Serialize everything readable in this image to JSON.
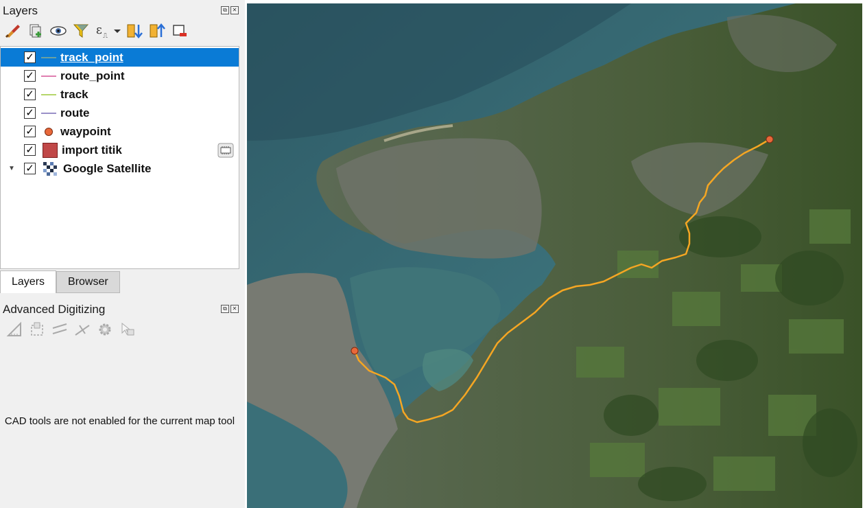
{
  "layers_panel": {
    "title": "Layers",
    "toolbar": [
      "paint-style-icon",
      "add-group-icon",
      "visibility-eye-icon",
      "filter-legend-icon",
      "filter-expression-icon",
      "expand-all-icon",
      "collapse-all-icon",
      "remove-layer-icon"
    ],
    "layers": [
      {
        "name": "track_point",
        "checked": true,
        "symbol": "line",
        "color": "#6aa0a0",
        "selected": true
      },
      {
        "name": "route_point",
        "checked": true,
        "symbol": "line",
        "color": "#e07fb0",
        "selected": false
      },
      {
        "name": "track",
        "checked": true,
        "symbol": "line",
        "color": "#b5d66a",
        "selected": false
      },
      {
        "name": "route",
        "checked": true,
        "symbol": "line",
        "color": "#9a90c8",
        "selected": false
      },
      {
        "name": "waypoint",
        "checked": true,
        "symbol": "point",
        "color": "#e8683a",
        "selected": false
      },
      {
        "name": "import titik",
        "checked": true,
        "symbol": "fill",
        "color": "#c04848",
        "selected": false
      },
      {
        "name": "Google Satellite",
        "checked": true,
        "symbol": "raster",
        "color": "#333333",
        "selected": false
      }
    ]
  },
  "tabs": {
    "layers": "Layers",
    "browser": "Browser"
  },
  "digitizing_panel": {
    "title": "Advanced Digitizing",
    "toolbar": [
      "cad-ruler-icon",
      "construction-icon",
      "parallel-icon",
      "perpendicular-icon",
      "settings-gear-icon",
      "snap-cursor-icon"
    ],
    "message": "CAD tools are not enabled for the current map tool"
  },
  "map": {
    "route_color": "#f5a623",
    "waypoint_color": "#e8683a"
  },
  "dock_icons": {
    "float": "⧉",
    "close": "✕"
  },
  "check_mark": "✓",
  "expander_glyph": "▼"
}
